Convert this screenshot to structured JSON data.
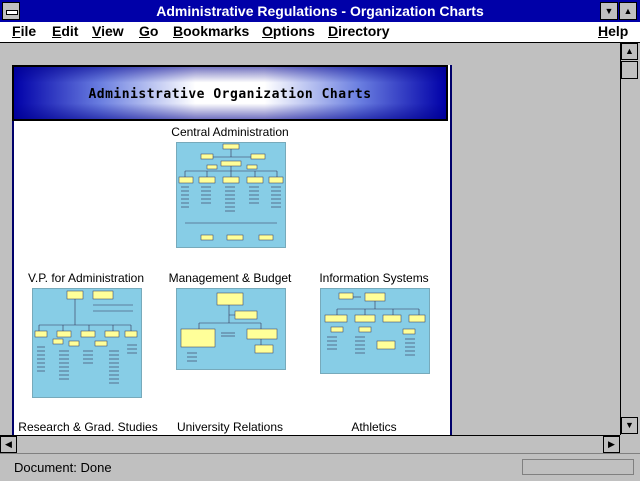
{
  "window": {
    "title": "Administrative Regulations - Organization Charts"
  },
  "menu": {
    "items": [
      "File",
      "Edit",
      "View",
      "Go",
      "Bookmarks",
      "Options",
      "Directory",
      "Help"
    ]
  },
  "page": {
    "banner_title": "Administrative Organization Charts",
    "charts": [
      {
        "label": "Central Administration"
      },
      {
        "label": "V.P. for Administration"
      },
      {
        "label": "Management & Budget"
      },
      {
        "label": "Information Systems"
      },
      {
        "label": "Research & Grad. Studies"
      },
      {
        "label": "University Relations"
      },
      {
        "label": "Athletics"
      }
    ]
  },
  "status": {
    "text": "Document: Done"
  },
  "colors": {
    "titlebar": "#0000a8",
    "thumb_bg": "#87cde6",
    "box_fill": "#ffff99"
  },
  "icons": [
    "system-menu-icon",
    "minimize-icon",
    "maximize-icon",
    "scroll-up-icon",
    "scroll-down-icon",
    "scroll-left-icon",
    "scroll-right-icon"
  ]
}
